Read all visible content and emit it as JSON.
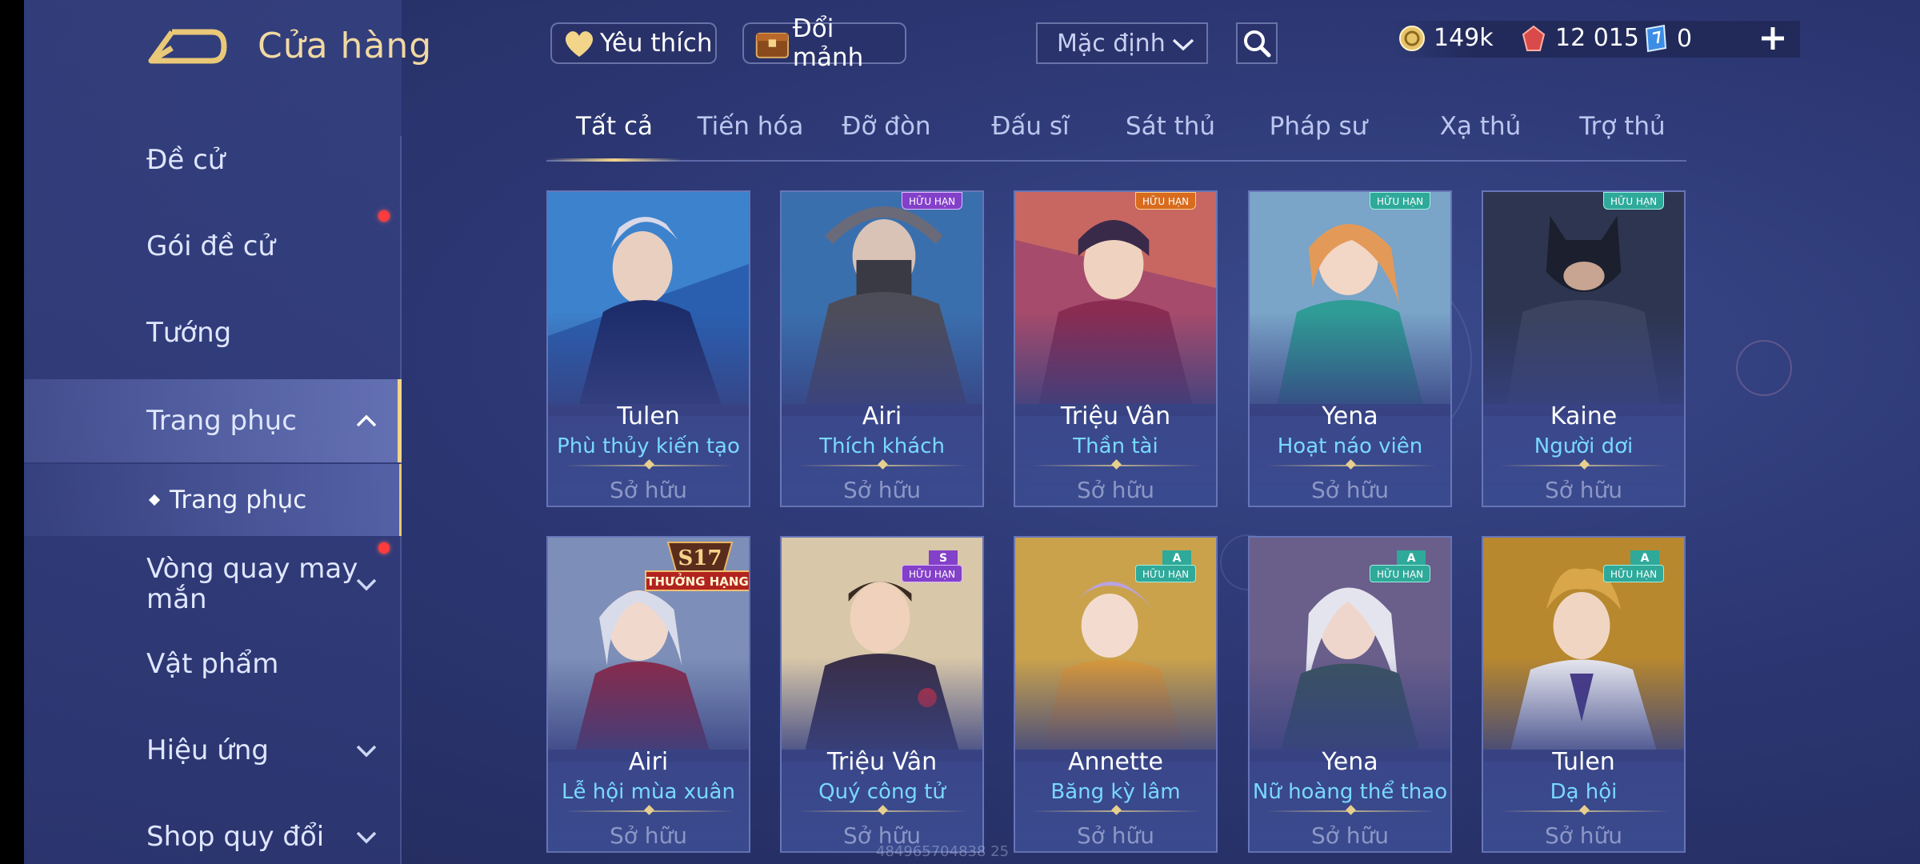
{
  "header": {
    "title": "Cửa hàng",
    "favorites_label": "Yêu thích",
    "exchange_label": "Đổi mảnh",
    "sort_value": "Mặc định"
  },
  "currency": {
    "gold": "149k",
    "vouchers": "12 015",
    "tokens": "0"
  },
  "sidebar": {
    "items": [
      {
        "label": "Đề cử"
      },
      {
        "label": "Gói đề cử"
      },
      {
        "label": "Tướng"
      },
      {
        "label": "Trang phục"
      },
      {
        "label": "Vòng quay may mắn"
      },
      {
        "label": "Vật phẩm"
      },
      {
        "label": "Hiệu ứng"
      },
      {
        "label": "Shop quy đổi"
      }
    ],
    "sub_item": "Trang phục",
    "vong_line1": "Vòng quay may",
    "vong_line2": "mắn"
  },
  "tabs": [
    "Tất cả",
    "Tiến hóa",
    "Đỡ đòn",
    "Đấu sĩ",
    "Sát thủ",
    "Pháp sư",
    "Xạ thủ",
    "Trợ thủ"
  ],
  "badges": {
    "huu_han": "HỮU HẠN",
    "rank_season": "S17",
    "rank_label": "THƯỞNG HẠNG",
    "tier_s": "S",
    "tier_a": "A"
  },
  "cards": [
    {
      "hero": "Tulen",
      "skin": "Phù thủy kiến tạo",
      "status": "Sở hữu"
    },
    {
      "hero": "Airi",
      "skin": "Thích khách",
      "status": "Sở hữu"
    },
    {
      "hero": "Triệu Vân",
      "skin": "Thần tài",
      "status": "Sở hữu"
    },
    {
      "hero": "Yena",
      "skin": "Hoạt náo viên",
      "status": "Sở hữu"
    },
    {
      "hero": "Kaine",
      "skin": "Người dơi",
      "status": "Sở hữu"
    },
    {
      "hero": "Airi",
      "skin": "Lễ hội mùa xuân",
      "status": "Sở hữu"
    },
    {
      "hero": "Triệu Vân",
      "skin": "Quý công tử",
      "status": "Sở hữu"
    },
    {
      "hero": "Annette",
      "skin": "Băng kỳ lâm",
      "status": "Sở hữu"
    },
    {
      "hero": "Yena",
      "skin": "Nữ hoàng thể thao",
      "status": "Sở hữu"
    },
    {
      "hero": "Tulen",
      "skin": "Dạ hội",
      "status": "Sở hữu"
    }
  ],
  "watermark": "484965704838 25",
  "colors": {
    "accent_gold": "#f3d58a",
    "skin_name": "#79d9ff",
    "notification": "#ff3b3b"
  }
}
